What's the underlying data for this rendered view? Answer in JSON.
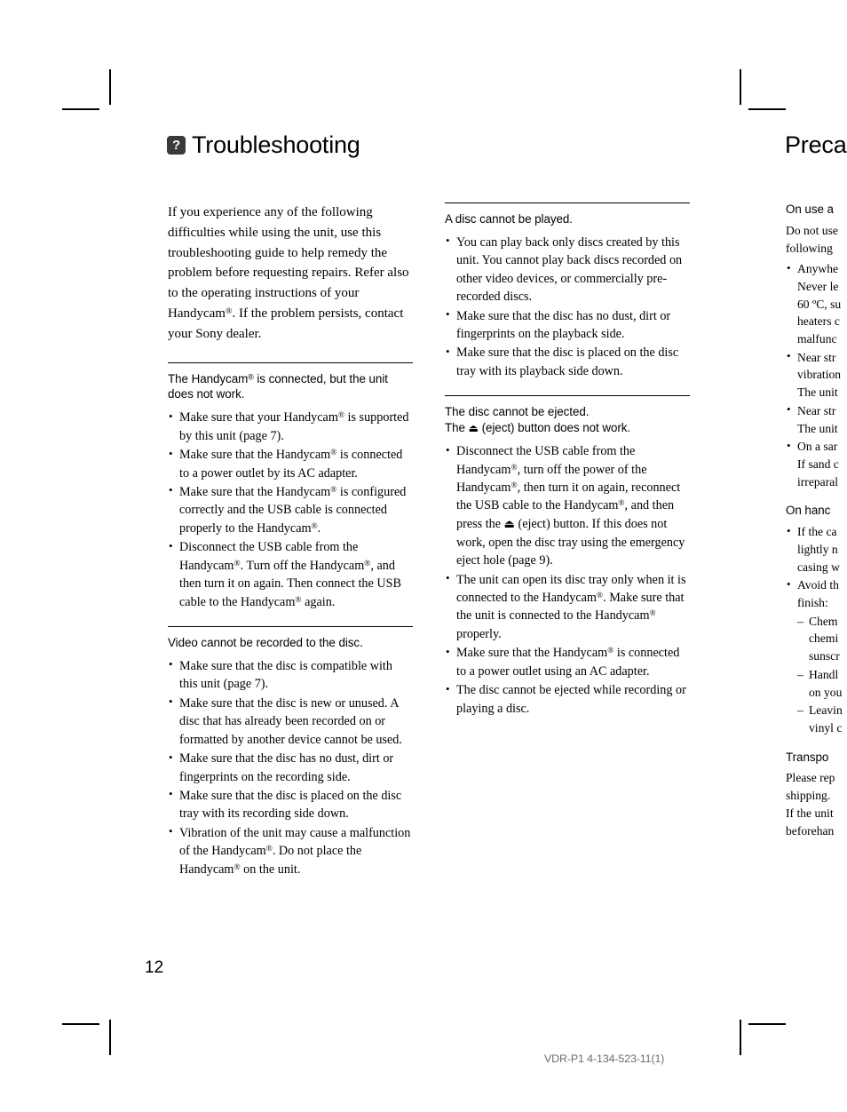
{
  "document": {
    "page_number": "12",
    "footer_code": "VDR-P1 4-134-523-11(1)"
  },
  "title": {
    "icon": "question-mark-badge-icon",
    "icon_glyph": "?",
    "text": "Troubleshooting"
  },
  "right_page": {
    "title": "Preca",
    "sections": [
      {
        "heading": "On use a",
        "intro_lines": [
          "Do not usе",
          "following "
        ],
        "bullets": [
          [
            "Anywhe",
            "Never le",
            "60 ºC, su",
            "heaters с",
            "malfunc"
          ],
          [
            "Near str",
            "vibration",
            "The unit"
          ],
          [
            "Near str",
            "The unit"
          ],
          [
            "On a sar",
            "If sand с",
            "irreparal"
          ]
        ]
      },
      {
        "heading": "On hanc",
        "bullets": [
          [
            "If the ca",
            "lightly n",
            "casing w"
          ],
          [
            "Avoid th",
            "finish:"
          ]
        ],
        "sub_bullets": [
          [
            "– Chem",
            "chemi",
            "sunscr"
          ],
          [
            "– Handl",
            "on you"
          ],
          [
            "– Leavin",
            "vinyl с"
          ]
        ]
      },
      {
        "heading": "Transpo",
        "lines": [
          "Please rep",
          "shipping.",
          "If the unit",
          "beforehan"
        ]
      }
    ]
  },
  "column_1": {
    "intro": "If you experience any of the following difficulties while using the unit, use this troubleshooting guide to help remedy the problem before requesting repairs. Refer also to the operating instructions of your Handycam®. If the problem persists, contact your Sony dealer.",
    "sections": [
      {
        "id": "handycam-connected-unit-does-not-work",
        "rule_above": true,
        "heading": "The Handycam® is connected, but the unit does not work.",
        "bullets": [
          "Make sure that your Handycam® is supported by this unit (page 7).",
          "Make sure that the Handycam® is connected to a power outlet by its AC adapter.",
          "Make sure that the Handycam® is configured correctly and the USB cable is connected properly to the Handycam®.",
          "Disconnect the USB cable from the Handycam®. Turn off the Handycam®, and then turn it on again. Then connect the USB cable to the Handycam® again."
        ]
      },
      {
        "id": "video-cannot-be-recorded",
        "rule_above": true,
        "heading": "Video cannot be recorded to the disc.",
        "bullets": [
          "Make sure that the disc is compatible with this unit (page 7).",
          "Make sure that the disc is new or unused. A disc that has already been recorded on or formatted by another device cannot be used.",
          "Make sure that the disc has no dust, dirt or fingerprints on the recording side.",
          "Make sure that the disc is placed on the disc tray with its recording side down.",
          "Vibration of the unit may cause a malfunction of the Handycam®. Do not place the Handycam® on the unit."
        ]
      }
    ]
  },
  "column_2": {
    "sections": [
      {
        "id": "disc-cannot-be-played",
        "rule_above": true,
        "heading": "A disc cannot be played.",
        "bullets": [
          "You can play back only discs created by this unit. You cannot play back discs recorded on other video devices, or commercially pre-recorded discs.",
          "Make sure that the disc has no dust, dirt or fingerprints on the playback side.",
          "Make sure that the disc is placed on the disc tray with its playback side down."
        ]
      },
      {
        "id": "disc-cannot-be-ejected",
        "rule_above": true,
        "heading_line_1": "The disc cannot be ejected.",
        "heading_line_2_pre": "The ",
        "heading_eject_glyph": "⏏",
        "heading_line_2_post": " (eject) button does not work.",
        "bullets": [
          "Disconnect the USB cable from the Handycam®, turn off the power of the Handycam®, then turn it on again, reconnect the USB cable to the Handycam®, and then press the ⏏ (eject) button. If this does not work, open the disc tray using the emergency eject hole (page 9).",
          "The unit can open its disc tray only when it is connected to the Handycam®. Make sure that the unit is connected to the Handycam® properly.",
          "Make sure that the Handycam® is connected to a power outlet using an AC adapter.",
          "The disc cannot be ejected while recording or playing a disc."
        ]
      }
    ]
  }
}
